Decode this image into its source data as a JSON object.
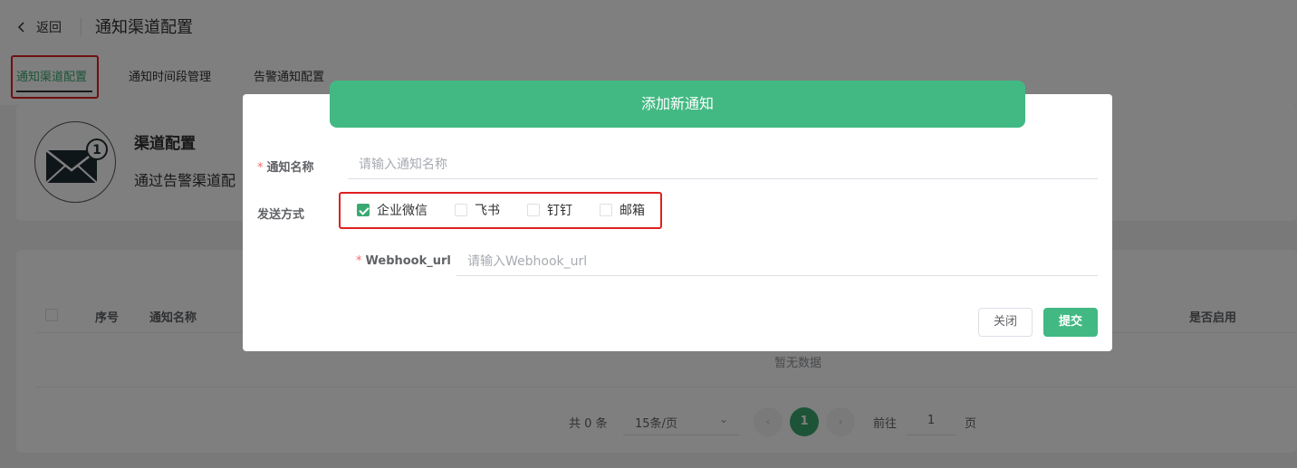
{
  "header": {
    "back_label": "返回",
    "title": "通知渠道配置"
  },
  "tabs": [
    {
      "label": "通知渠道配置"
    },
    {
      "label": "通知时间段管理"
    },
    {
      "label": "告警通知配置"
    }
  ],
  "intro_card": {
    "badge": "1",
    "title": "渠道配置",
    "description": "通过告警渠道配"
  },
  "table": {
    "headers": [
      "序号",
      "通知名称",
      "是否启用"
    ],
    "empty_text": "暂无数据"
  },
  "pagination": {
    "total_text": "共 0 条",
    "page_size": "15条/页",
    "current_page": "1",
    "goto_label": "前往",
    "goto_value": "1",
    "page_unit": "页"
  },
  "dialog": {
    "title": "添加新通知",
    "name_label": "通知名称",
    "name_placeholder": "请输入通知名称",
    "method_label": "发送方式",
    "methods": [
      {
        "label": "企业微信",
        "checked": true
      },
      {
        "label": "飞书",
        "checked": false
      },
      {
        "label": "钉钉",
        "checked": false
      },
      {
        "label": "邮箱",
        "checked": false
      }
    ],
    "webhook_label": "Webhook_url",
    "webhook_placeholder": "请输入Webhook_url",
    "close_label": "关闭",
    "submit_label": "提交"
  },
  "colors": {
    "primary": "#42b983",
    "highlight": "#e02020",
    "required": "#f56c6c"
  }
}
